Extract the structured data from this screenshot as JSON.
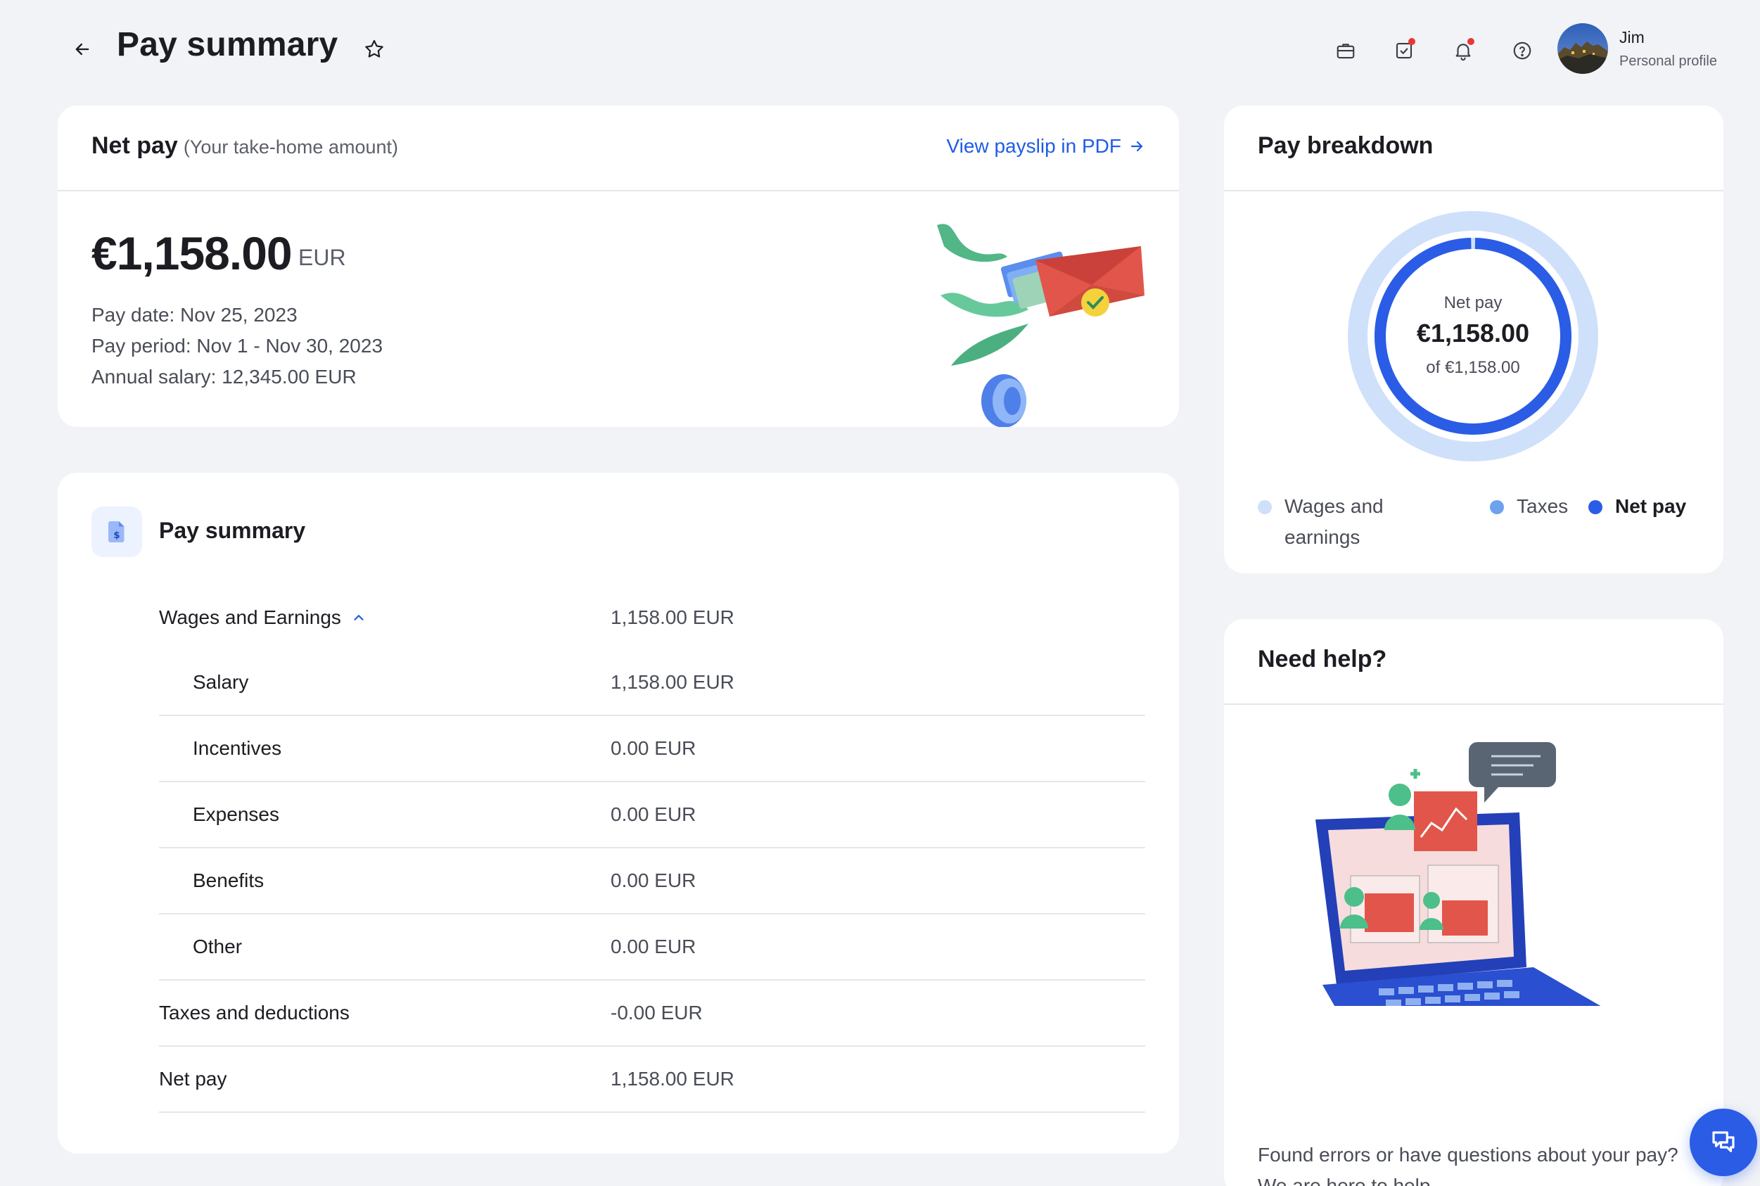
{
  "header": {
    "title": "Pay summary",
    "user": {
      "name": "Jim",
      "subtitle": "Personal profile"
    }
  },
  "net_pay": {
    "title": "Net pay",
    "subtitle": "(Your take-home amount)",
    "pdf_link": "View payslip in PDF",
    "amount": "€1,158.00",
    "currency": "EUR",
    "pay_date": "Pay date: Nov 25, 2023",
    "pay_period": "Pay period: Nov 1 - Nov 30, 2023",
    "annual_salary": "Annual salary: 12,345.00 EUR"
  },
  "summary": {
    "title": "Pay summary",
    "wages": {
      "label": "Wages and Earnings",
      "value": "1,158.00 EUR"
    },
    "items": [
      {
        "label": "Salary",
        "value": "1,158.00 EUR"
      },
      {
        "label": "Incentives",
        "value": "0.00 EUR"
      },
      {
        "label": "Expenses",
        "value": "0.00 EUR"
      },
      {
        "label": "Benefits",
        "value": "0.00 EUR"
      },
      {
        "label": "Other",
        "value": "0.00 EUR"
      }
    ],
    "taxes": {
      "label": "Taxes and deductions",
      "value": "-0.00 EUR"
    },
    "net": {
      "label": "Net pay",
      "value": "1,158.00 EUR"
    }
  },
  "breakdown": {
    "title": "Pay breakdown",
    "center_label": "Net pay",
    "center_amount": "€1,158.00",
    "center_total": "of €1,158.00",
    "net_fraction": 1.0,
    "legend": [
      {
        "label": "Wages and earnings",
        "color": "#cfe0fb"
      },
      {
        "label": "Taxes",
        "color": "#6ea2ee"
      },
      {
        "label": "Net pay",
        "color": "#2a5ce6"
      }
    ]
  },
  "help": {
    "title": "Need help?",
    "text": "Found errors or have questions about your pay? We are here to help."
  },
  "colors": {
    "accent": "#2a5ce6",
    "link": "#1f5ce8",
    "ring_light": "#cfe0fb"
  }
}
